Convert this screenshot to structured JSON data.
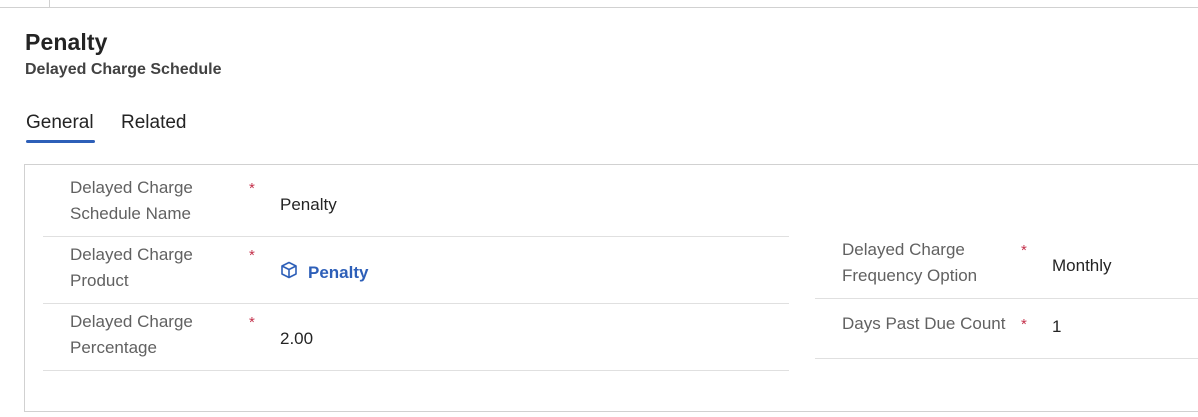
{
  "header": {
    "title": "Penalty",
    "subtitle": "Delayed Charge Schedule"
  },
  "tabs": [
    {
      "label": "General",
      "selected": true
    },
    {
      "label": "Related",
      "selected": false
    }
  ],
  "form": {
    "left": [
      {
        "label_line1": "Delayed Charge",
        "label_line2": "Schedule Name",
        "required": "*",
        "value": "Penalty"
      },
      {
        "label_line1": "Delayed Charge",
        "label_line2": "Product",
        "required": "*",
        "value": "Penalty",
        "icon": "product-box-icon"
      },
      {
        "label_line1": "Delayed Charge",
        "label_line2": "Percentage",
        "required": "*",
        "value": "2.00"
      }
    ],
    "right": [
      {
        "label_line1": "Delayed Charge",
        "label_line2": "Frequency Option",
        "required": "*",
        "value": "Monthly"
      },
      {
        "label_line1": "Days Past Due Count",
        "required": "*",
        "value": "1"
      }
    ]
  },
  "colors": {
    "accent": "#2d5fb8",
    "required": "#c4314b",
    "label": "#616161"
  }
}
